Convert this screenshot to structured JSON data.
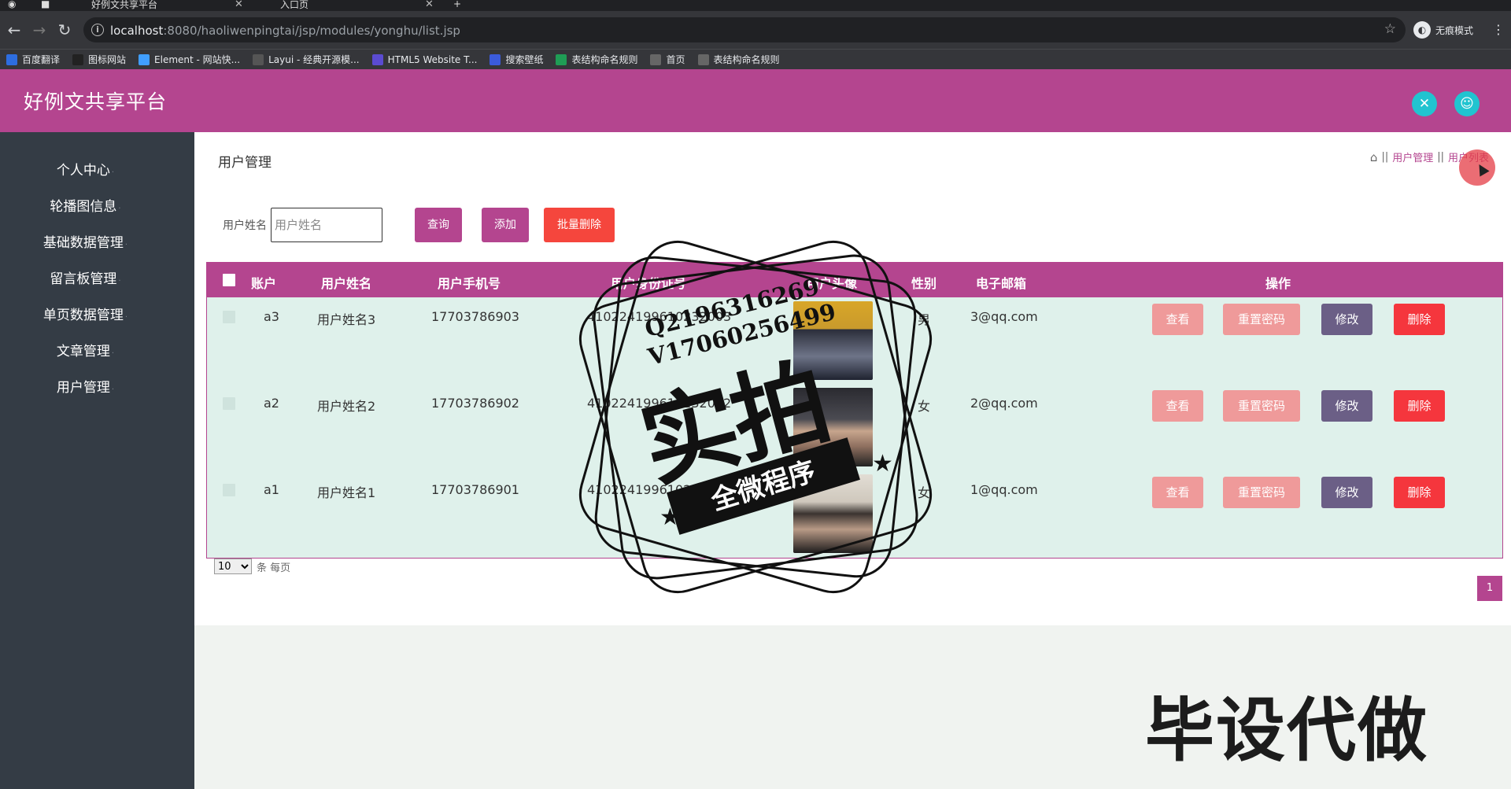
{
  "browser": {
    "tabs": [
      {
        "title": "好例文共享平台"
      },
      {
        "title": "入口页"
      }
    ],
    "url_host": "localhost",
    "url_rest": ":8080/haoliwenpingtai/jsp/modules/yonghu/list.jsp",
    "incognito_label": "无痕模式",
    "bookmarks": [
      {
        "label": "百度翻译",
        "icon": "translate-icon",
        "color": "#2d6de0"
      },
      {
        "label": "图标网站",
        "icon": "flag-icon",
        "color": "#222222"
      },
      {
        "label": "Element - 网站快...",
        "icon": "element-icon",
        "color": "#409eff"
      },
      {
        "label": "Layui - 经典开源模...",
        "icon": "layui-icon",
        "color": "#555555"
      },
      {
        "label": "HTML5 Website T...",
        "icon": "html5-icon",
        "color": "#5b4bd1"
      },
      {
        "label": "搜索壁纸",
        "icon": "wallpaper-icon",
        "color": "#3b5bdb"
      },
      {
        "label": "表结构命名规则",
        "icon": "sheet-icon",
        "color": "#1f9d55"
      },
      {
        "label": "首页",
        "icon": "globe-icon",
        "color": "#666666"
      },
      {
        "label": "表结构命名规则",
        "icon": "globe-icon",
        "color": "#666666"
      }
    ]
  },
  "app": {
    "title": "好例文共享平台",
    "accent": "#b4458f"
  },
  "sidebar": {
    "items": [
      {
        "label": "个人中心"
      },
      {
        "label": "轮播图信息"
      },
      {
        "label": "基础数据管理"
      },
      {
        "label": "留言板管理"
      },
      {
        "label": "单页数据管理"
      },
      {
        "label": "文章管理"
      },
      {
        "label": "用户管理"
      }
    ]
  },
  "main": {
    "title": "用户管理",
    "breadcrumb": [
      "用户管理",
      "用户列表"
    ],
    "search": {
      "label": "用户姓名",
      "placeholder": "用户姓名",
      "value": ""
    },
    "buttons": {
      "query": "查询",
      "add": "添加",
      "bulk_delete": "批量删除"
    },
    "table": {
      "headers": [
        "账户",
        "用户姓名",
        "用户手机号",
        "用户身份证号",
        "用户头像",
        "性别",
        "电子邮箱",
        "操作"
      ],
      "rows": [
        {
          "account": "a3",
          "name": "用户姓名3",
          "phone": "17703786903",
          "id_card": "410224199610232003",
          "gender": "男",
          "email": "3@qq.com"
        },
        {
          "account": "a2",
          "name": "用户姓名2",
          "phone": "17703786902",
          "id_card": "410224199610232002",
          "gender": "女",
          "email": "2@qq.com"
        },
        {
          "account": "a1",
          "name": "用户姓名1",
          "phone": "17703786901",
          "id_card": "410224199610232001",
          "gender": "女",
          "email": "1@qq.com"
        }
      ],
      "row_actions": {
        "view": "查看",
        "reset_password": "重置密码",
        "edit": "修改",
        "delete": "删除"
      }
    },
    "pagination": {
      "page_size": "10",
      "page_size_suffix": "条 每页",
      "current_page": "1"
    }
  },
  "watermark": {
    "line1": "Q2196316269",
    "line2": "V17060256499",
    "big": "实拍",
    "ribbon": "全微程序",
    "corner": "毕设代做"
  }
}
